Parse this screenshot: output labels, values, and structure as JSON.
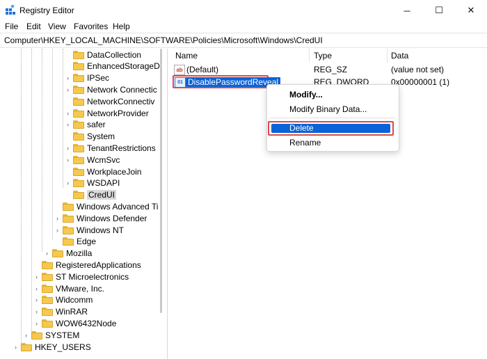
{
  "window": {
    "title": "Registry Editor",
    "controls": {
      "minimize": "─",
      "maximize": "☐",
      "close": "✕"
    }
  },
  "menu": [
    "File",
    "Edit",
    "View",
    "Favorites",
    "Help"
  ],
  "address": "Computer\\HKEY_LOCAL_MACHINE\\SOFTWARE\\Policies\\Microsoft\\Windows\\CredUI",
  "tree": [
    {
      "label": "DataCollection",
      "chevron": false
    },
    {
      "label": "EnhancedStorageD",
      "chevron": false
    },
    {
      "label": "IPSec",
      "chevron": true
    },
    {
      "label": "Network Connectic",
      "chevron": true
    },
    {
      "label": "NetworkConnectiv",
      "chevron": false
    },
    {
      "label": "NetworkProvider",
      "chevron": true
    },
    {
      "label": "safer",
      "chevron": true
    },
    {
      "label": "System",
      "chevron": false
    },
    {
      "label": "TenantRestrictions",
      "chevron": true
    },
    {
      "label": "WcmSvc",
      "chevron": true
    },
    {
      "label": "WorkplaceJoin",
      "chevron": false
    },
    {
      "label": "WSDAPI",
      "chevron": true
    },
    {
      "label": "CredUI",
      "chevron": false,
      "selected": true
    },
    {
      "label": "Windows Advanced Ti",
      "chevron": false
    },
    {
      "label": "Windows Defender",
      "chevron": true
    },
    {
      "label": "Windows NT",
      "chevron": true
    },
    {
      "label": "Edge",
      "chevron": false
    },
    {
      "label": "Mozilla",
      "chevron": true
    },
    {
      "label": "RegisteredApplications",
      "chevron": false
    },
    {
      "label": "ST Microelectronics",
      "chevron": true
    },
    {
      "label": "VMware, Inc.",
      "chevron": true
    },
    {
      "label": "Widcomm",
      "chevron": true
    },
    {
      "label": "WinRAR",
      "chevron": true
    },
    {
      "label": "WOW6432Node",
      "chevron": true
    },
    {
      "label": "SYSTEM",
      "chevron": true
    },
    {
      "label": "HKEY_USERS",
      "chevron": true
    }
  ],
  "columns": {
    "name": "Name",
    "type": "Type",
    "data": "Data"
  },
  "values": [
    {
      "icon": "ab",
      "name": "(Default)",
      "type": "REG_SZ",
      "data": "(value not set)"
    },
    {
      "icon": "011\n110",
      "name": "DisablePasswordReveal",
      "type": "REG_DWORD",
      "data": "0x00000001 (1)"
    }
  ],
  "context_menu": {
    "modify": "Modify...",
    "modify_binary": "Modify Binary Data...",
    "delete": "Delete",
    "rename": "Rename"
  },
  "colors": {
    "selection": "#0a64d8",
    "highlight_outline": "#e04848",
    "folder": "#f6c94e"
  }
}
